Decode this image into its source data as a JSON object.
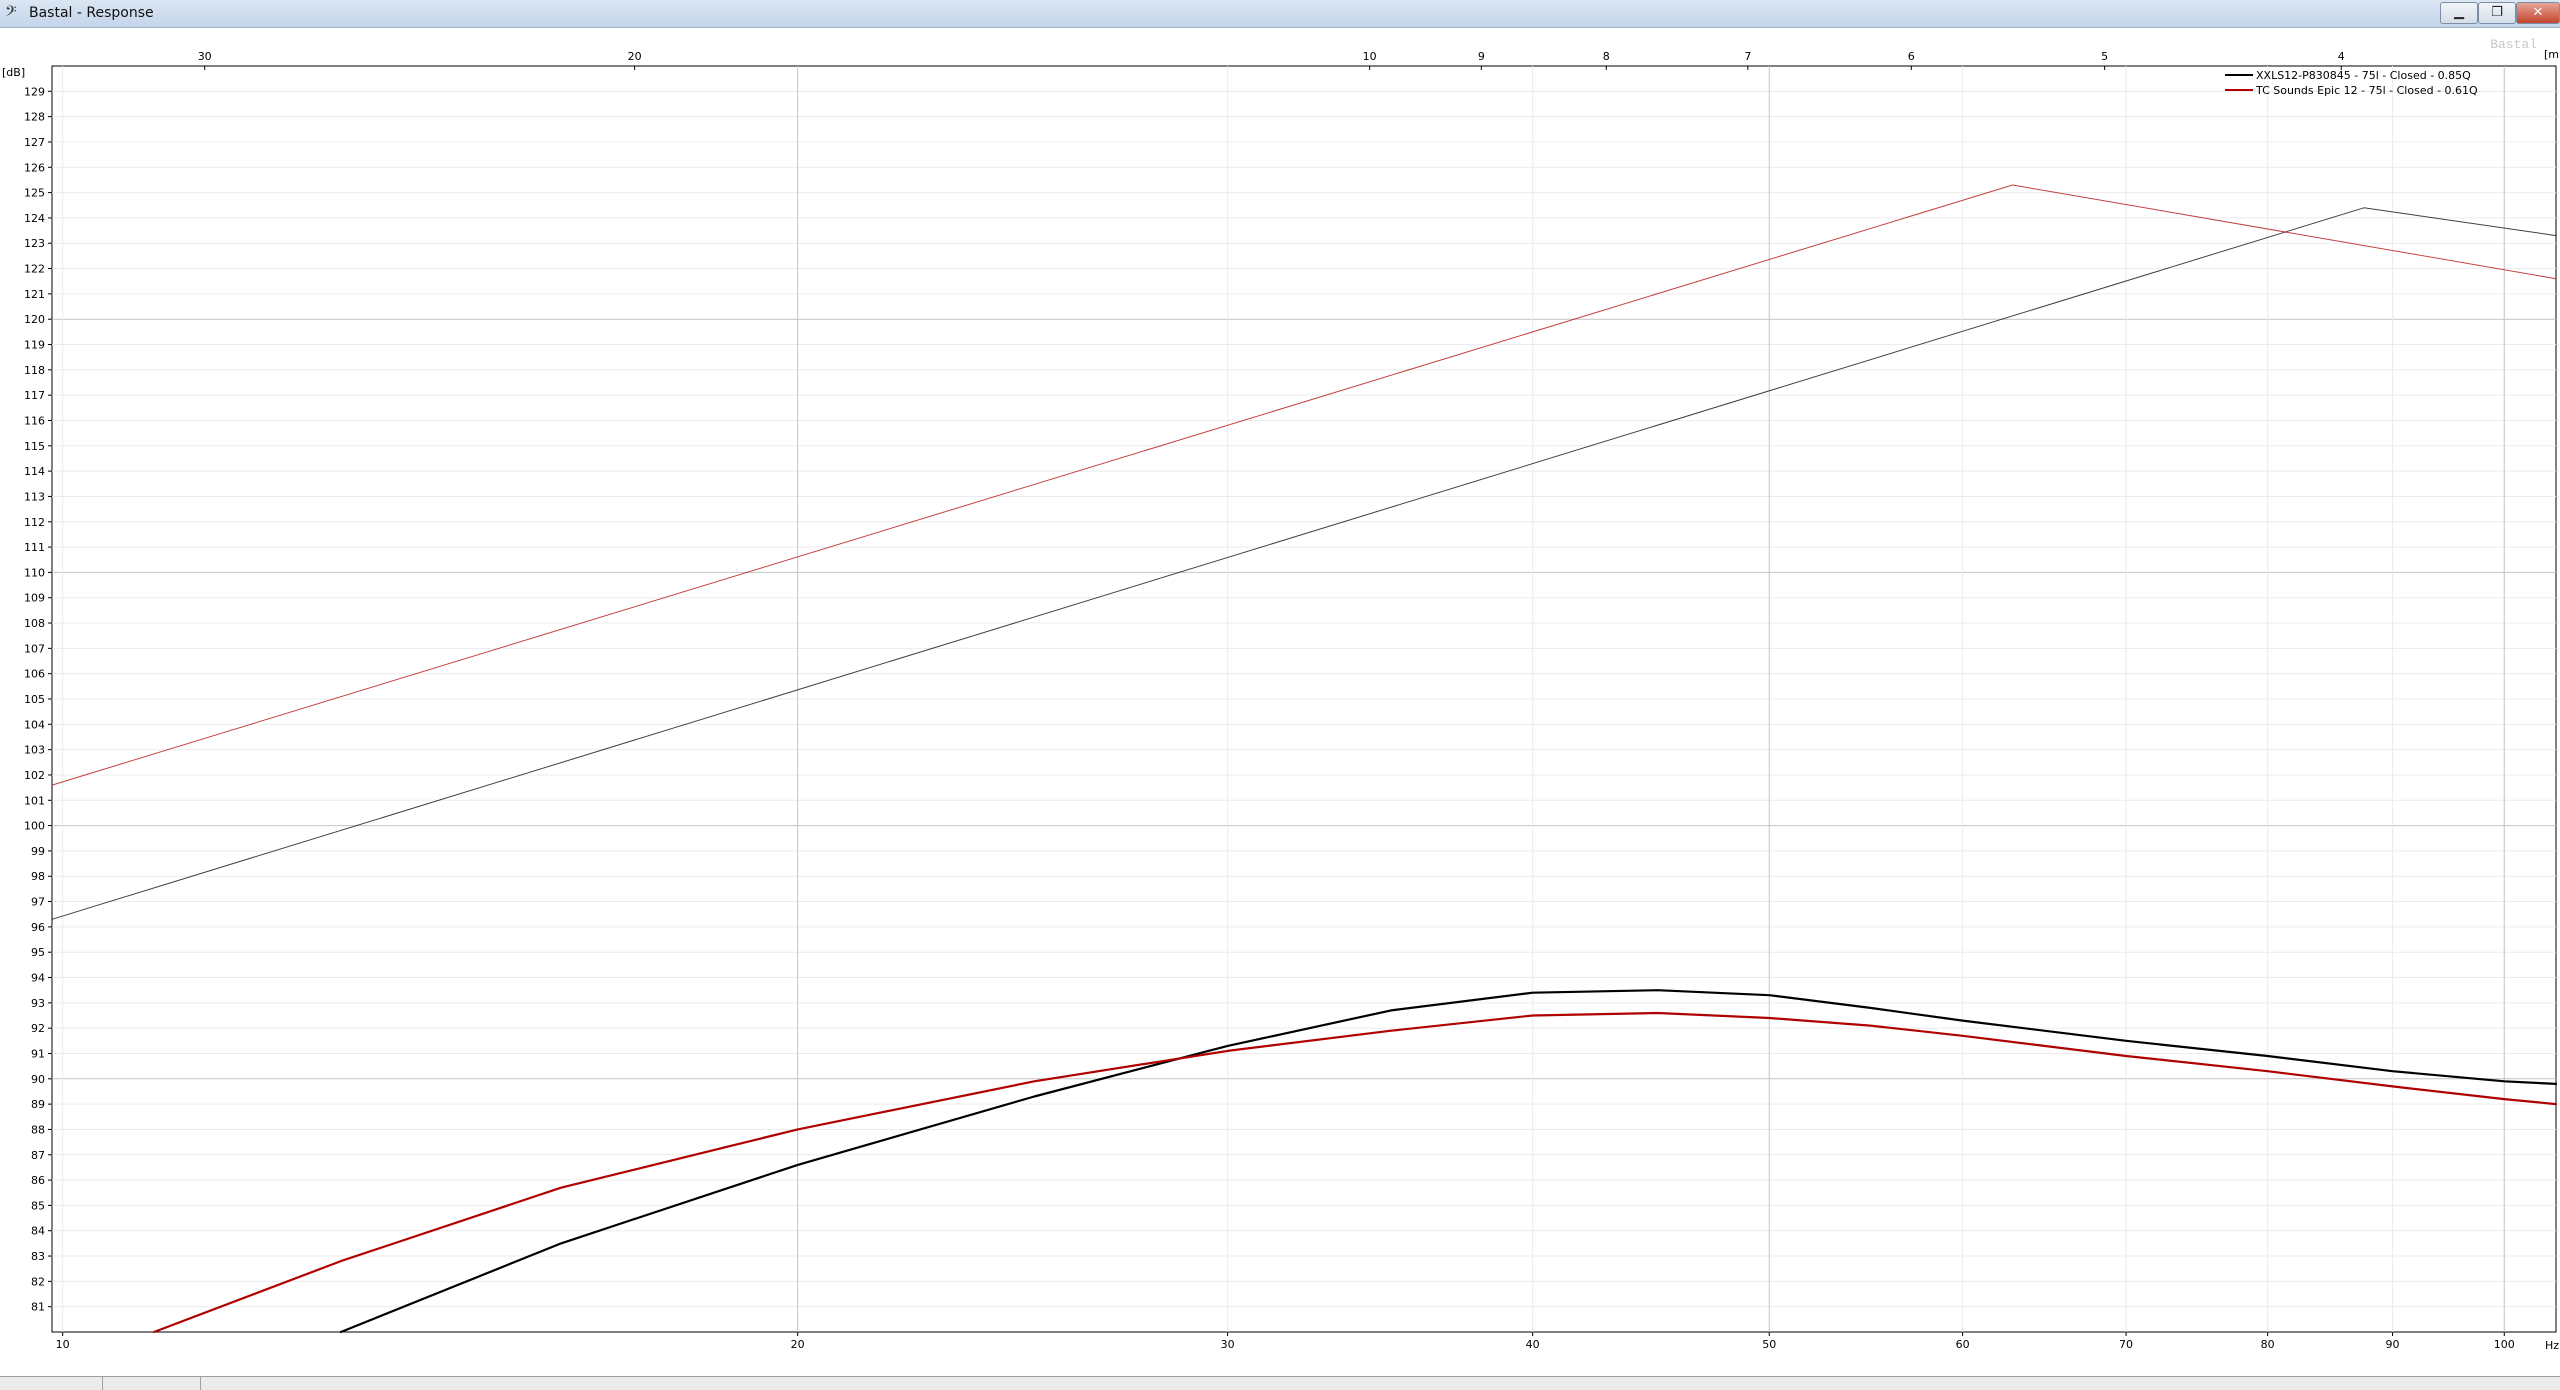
{
  "window": {
    "title": "Bastal - Response",
    "app_icon": "bass-clef-icon",
    "minimize_label": "▁",
    "restore_label": "❐",
    "close_label": "✕"
  },
  "chart_data": {
    "type": "line",
    "title": "",
    "watermark": "Bastal",
    "ylabel": "[dB]",
    "xlabel": "Hz",
    "top_axis_label": "[m]",
    "x_scale": "log",
    "xlim": [
      9.9,
      105
    ],
    "ylim": [
      80,
      130
    ],
    "x_ticks": [
      10,
      20,
      30,
      40,
      50,
      60,
      70,
      80,
      90,
      100
    ],
    "top_ticks_m": [
      30,
      20,
      10,
      9,
      8,
      7,
      6,
      5,
      4
    ],
    "speed_of_sound": 343,
    "y_ticks": [
      81,
      82,
      83,
      84,
      85,
      86,
      87,
      88,
      89,
      90,
      91,
      92,
      93,
      94,
      95,
      96,
      97,
      98,
      99,
      100,
      101,
      102,
      103,
      104,
      105,
      106,
      107,
      108,
      109,
      110,
      111,
      112,
      113,
      114,
      115,
      116,
      117,
      118,
      119,
      120,
      121,
      122,
      123,
      124,
      125,
      126,
      127,
      128,
      129
    ],
    "grid": true,
    "legend_position": "top-right",
    "series": [
      {
        "name": "XXLS12-P830845 - 75l - Closed - 0.85Q",
        "color": "#000000",
        "curves": [
          {
            "style": "thin",
            "x": [
              9.9,
              87.6,
              105
            ],
            "y": [
              96.3,
              124.4,
              123.3
            ]
          },
          {
            "style": "thick",
            "x": [
              13.0,
              16,
              20,
              25,
              30,
              35,
              40,
              45,
              50,
              55,
              60,
              70,
              80,
              90,
              100,
              105
            ],
            "y": [
              80.0,
              83.5,
              86.6,
              89.3,
              91.3,
              92.7,
              93.4,
              93.5,
              93.3,
              92.8,
              92.3,
              91.5,
              90.9,
              90.3,
              89.9,
              89.8
            ]
          }
        ]
      },
      {
        "name": "TC Sounds Epic 12 - 75l - Closed - 0.61Q",
        "color": "#b00000",
        "curves": [
          {
            "style": "thin",
            "x": [
              9.9,
              62.9,
              105
            ],
            "y": [
              101.6,
              125.3,
              121.6
            ]
          },
          {
            "style": "thick",
            "x": [
              10.9,
              13,
              16,
              20,
              25,
              30,
              35,
              40,
              45,
              50,
              55,
              60,
              70,
              80,
              90,
              100,
              105
            ],
            "y": [
              80.0,
              82.8,
              85.7,
              88.0,
              89.9,
              91.1,
              91.9,
              92.5,
              92.6,
              92.4,
              92.1,
              91.7,
              90.9,
              90.3,
              89.7,
              89.2,
              89.0
            ]
          }
        ]
      }
    ]
  }
}
